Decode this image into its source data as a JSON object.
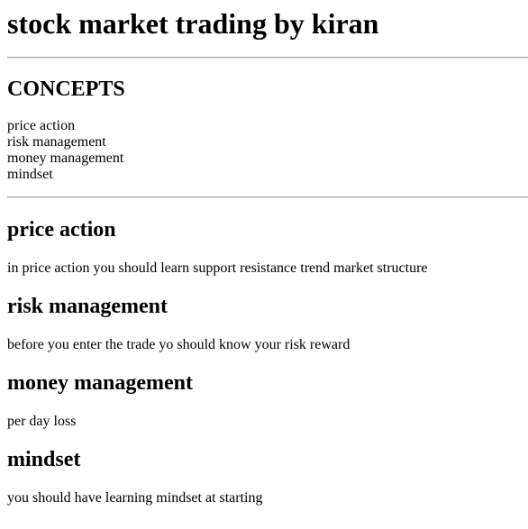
{
  "page": {
    "title": "stock market trading by kiran"
  },
  "concepts": {
    "heading": "CONCEPTS",
    "items": [
      "price action",
      "risk management",
      "money management",
      "mindset"
    ]
  },
  "sections": [
    {
      "heading": "price action",
      "text": "in price action you should learn support resistance trend market structure"
    },
    {
      "heading": "risk management",
      "text": "before you enter the trade yo should know your risk reward"
    },
    {
      "heading": "money management",
      "text": "per day loss"
    },
    {
      "heading": "mindset",
      "text": "you should have learning mindset at starting"
    }
  ]
}
